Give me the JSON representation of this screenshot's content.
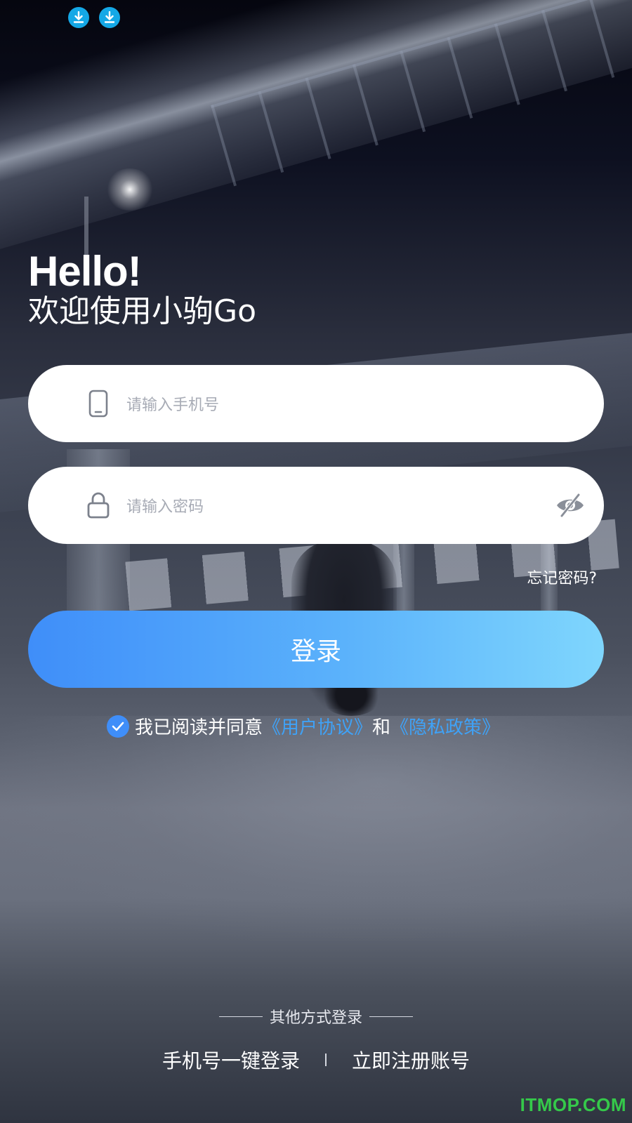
{
  "status_bar": {
    "icons": [
      "download-icon",
      "download-icon"
    ],
    "icon_color": "#14a8e6"
  },
  "header": {
    "hello": "Hello!",
    "welcome": "欢迎使用小驹Go"
  },
  "form": {
    "phone_placeholder": "请输入手机号",
    "phone_icon": "phone-icon",
    "password_placeholder": "请输入密码",
    "password_icon": "lock-icon",
    "visibility_icon": "eye-slash-icon",
    "forgot_label": "忘记密码?",
    "login_label": "登录"
  },
  "agreement": {
    "checked": true,
    "prefix": "我已阅读并同意",
    "user_agreement": "《用户协议》",
    "and": "和",
    "privacy_policy": "《隐私政策》",
    "link_color": "#3fa2f7"
  },
  "other_login": {
    "title": "其他方式登录",
    "one_click_login": "手机号一键登录",
    "register": "立即注册账号"
  },
  "watermark": "ITMOP.COM",
  "colors": {
    "accent": "#3f8ef9",
    "accent_light": "#7fd6fd",
    "placeholder": "#a7abb5",
    "watermark": "#35c94a"
  }
}
